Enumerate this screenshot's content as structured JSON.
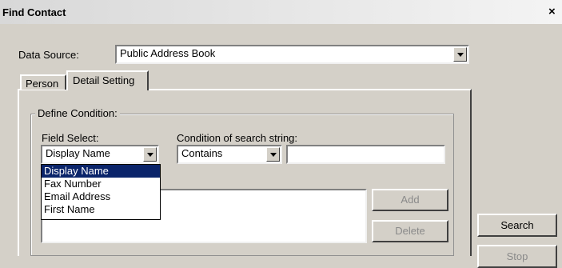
{
  "window": {
    "title": "Find Contact",
    "close_glyph": "×"
  },
  "data_source": {
    "label": "Data Source:",
    "value": "Public Address Book"
  },
  "tabs": [
    {
      "label": "Person"
    },
    {
      "label": "Detail Setting"
    }
  ],
  "define_condition": {
    "legend": "Define Condition:",
    "field_select": {
      "label": "Field Select:",
      "value": "Display Name",
      "options": [
        "Display Name",
        "Fax Number",
        "Email Address",
        "First Name"
      ]
    },
    "condition": {
      "label": "Condition of search string:",
      "value": "Contains"
    },
    "search_string": {
      "value": ""
    }
  },
  "buttons": {
    "add": "Add",
    "delete": "Delete",
    "search": "Search",
    "stop": "Stop"
  }
}
